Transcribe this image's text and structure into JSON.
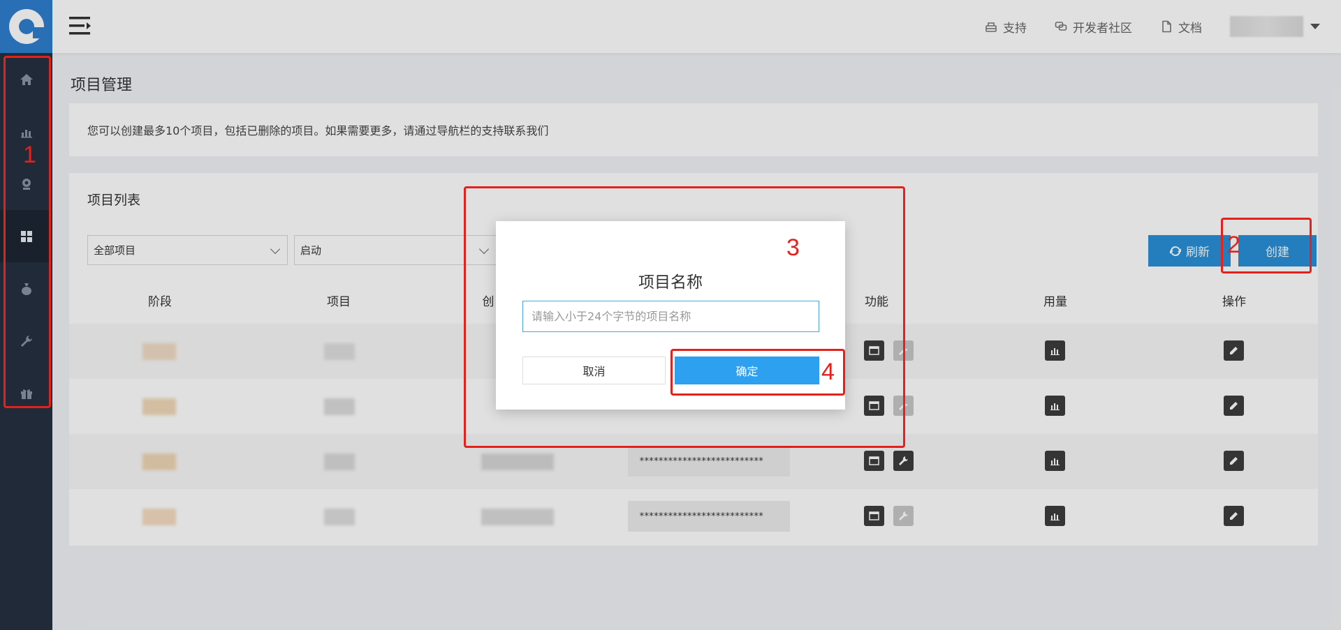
{
  "header": {
    "links": [
      {
        "label": "支持",
        "icon": "support-icon"
      },
      {
        "label": "开发者社区",
        "icon": "community-icon"
      },
      {
        "label": "文档",
        "icon": "document-icon"
      }
    ]
  },
  "sidebar": {
    "items": [
      {
        "icon": "home-icon"
      },
      {
        "icon": "chart-icon"
      },
      {
        "icon": "webcam-icon"
      },
      {
        "icon": "grid-icon",
        "active": true
      },
      {
        "icon": "money-bag-icon"
      },
      {
        "icon": "wrench-icon"
      },
      {
        "icon": "gift-icon"
      }
    ]
  },
  "page": {
    "title": "项目管理",
    "notice": "您可以创建最多10个项目，包括已删除的项目。如果需要更多，请通过导航栏的支持联系我们"
  },
  "panel": {
    "title": "项目列表",
    "filter_project": "全部项目",
    "filter_status": "启动",
    "refresh_label": "刷新",
    "create_label": "创建",
    "columns": [
      "阶段",
      "项目",
      "创",
      "功能",
      "用量",
      "操作"
    ]
  },
  "rows": [
    {
      "key": ""
    },
    {
      "key": ""
    },
    {
      "key": "**************************"
    },
    {
      "key": "**************************"
    }
  ],
  "modal": {
    "title": "项目名称",
    "input_placeholder": "请输入小于24个字节的项目名称",
    "cancel_label": "取消",
    "confirm_label": "确定"
  },
  "annotations": [
    "1",
    "2",
    "3",
    "4"
  ],
  "colors": {
    "sidebar": "#253041",
    "brand": "#2f7fd0",
    "primary_button": "#2a8fd8",
    "confirm_button": "#2ea0f0",
    "annotation": "#e5211c"
  }
}
